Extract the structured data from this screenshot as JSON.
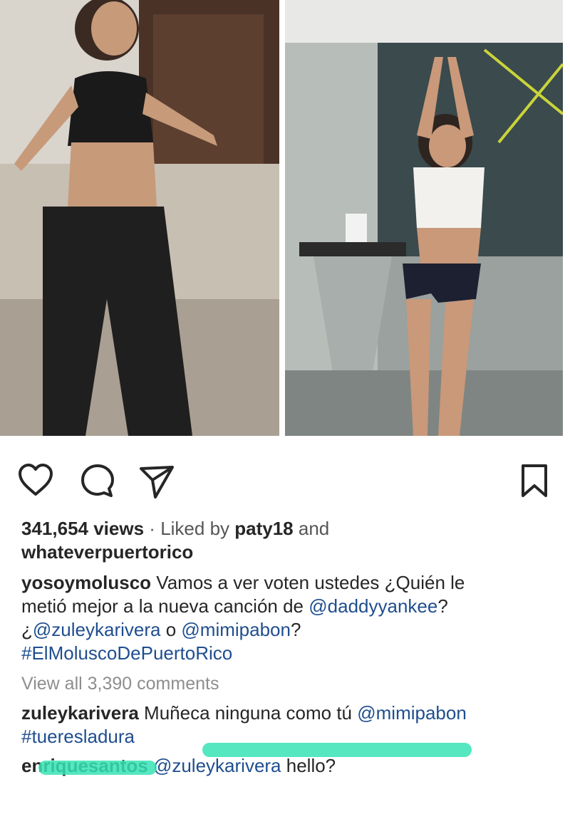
{
  "post": {
    "views": "341,654 views",
    "separator": "·",
    "liked_by_prefix": "Liked by",
    "liked_by_user": "paty18",
    "liked_by_and": "and",
    "liked_by_user2": "whateverpuertorico"
  },
  "caption": {
    "username": "yosoymolusco",
    "text1": "Vamos a ver voten ustedes ¿Quién le",
    "text2a": "metió mejor a la nueva canción de",
    "mention1": "@daddyyankee",
    "text2b": "?",
    "text3a": "¿",
    "mention2": "@zuleykarivera",
    "text3b": "o",
    "mention3": "@mimipabon",
    "text3c": "?",
    "hashtag": "#ElMoluscoDePuertoRico"
  },
  "comments_link": "View all 3,390 comments",
  "comments": [
    {
      "username": "zuleykarivera",
      "text": "Muñeca ninguna como tú",
      "mention": "@mimipabon",
      "hashtag": "#tueresladura"
    },
    {
      "username": "enriquesantos",
      "mention": "@zuleykarivera",
      "text": "hello?"
    }
  ],
  "icons": {
    "like": "heart-icon",
    "comment": "comment-icon",
    "share": "paper-plane-icon",
    "save": "bookmark-icon"
  },
  "colors": {
    "link": "#1f4e8f",
    "highlight": "#37e3b5",
    "text": "#262626",
    "muted": "#8e8e8e"
  }
}
